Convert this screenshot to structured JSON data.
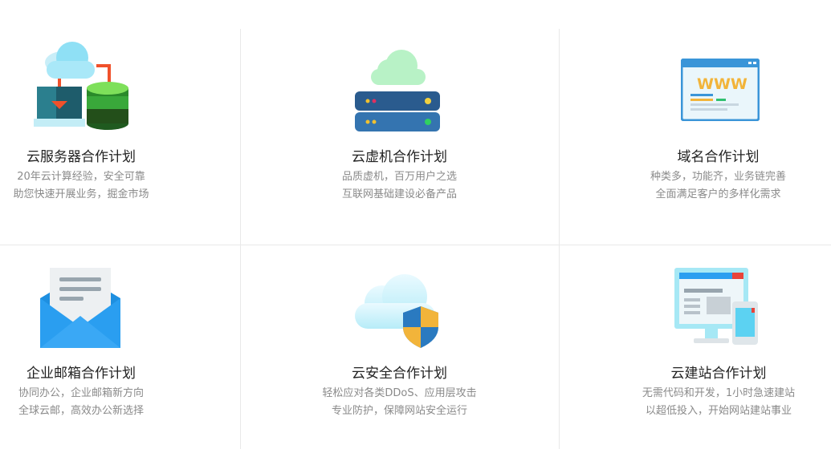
{
  "services": [
    {
      "title": "云服务器合作计划",
      "line1": "20年云计算经验，安全可靠",
      "line2": "助您快速开展业务，掘金市场",
      "icon": "cloud-server-icon"
    },
    {
      "title": "云虚机合作计划",
      "line1": "品质虚机，百万用户之选",
      "line2": "互联网基础建设必备产品",
      "icon": "virtual-host-icon"
    },
    {
      "title": "域名合作计划",
      "line1": "种类多，功能齐，业务链完善",
      "line2": "全面满足客户的多样化需求",
      "icon": "domain-www-icon"
    },
    {
      "title": "企业邮箱合作计划",
      "line1": "协同办公，企业邮箱新方向",
      "line2": "全球云邮，高效办公新选择",
      "icon": "mail-envelope-icon"
    },
    {
      "title": "云安全合作计划",
      "line1": "轻松应对各类DDoS、应用层攻击",
      "line2": "专业防护，保障网站安全运行",
      "icon": "cloud-security-shield-icon"
    },
    {
      "title": "云建站合作计划",
      "line1": "无需代码和开发，1小时急速建站",
      "line2": "以超低投入，开始网站建站事业",
      "icon": "website-builder-icon"
    }
  ],
  "icons": {
    "domain_label": "WWW"
  },
  "colors": {
    "title": "#222222",
    "description": "#8a8a8a",
    "divider": "#e9e9e9"
  }
}
